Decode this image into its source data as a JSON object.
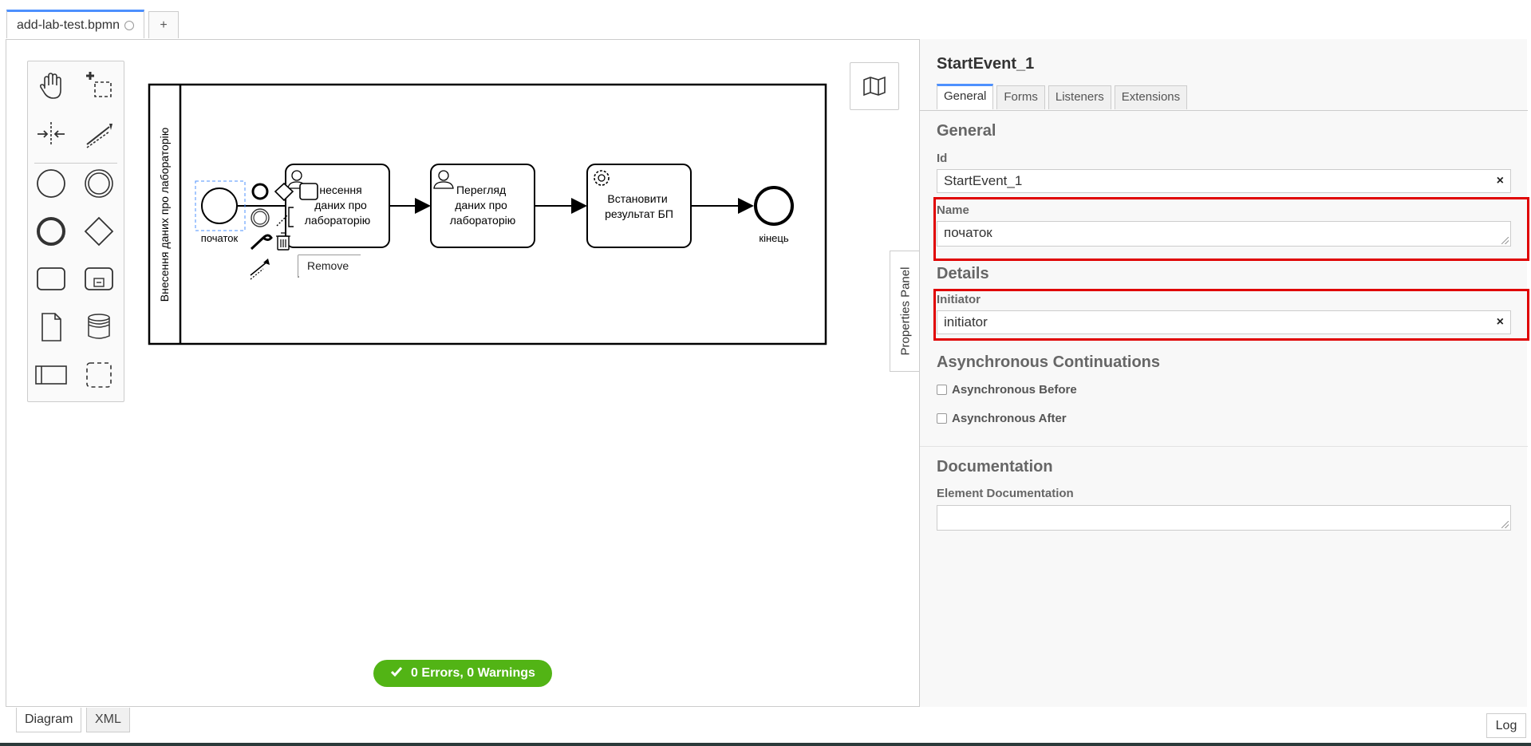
{
  "file_tab": {
    "name": "add-lab-test.bpmn"
  },
  "add_tab": {
    "label": "+"
  },
  "diagram": {
    "lane_label": "Внесення даних про лабораторію",
    "start_label": "початок",
    "task1": [
      "несення",
      "даних про",
      "лабораторію"
    ],
    "task2": [
      "Перегляд",
      "даних про",
      "лабораторію"
    ],
    "task3": [
      "Встановити",
      "результат БП"
    ],
    "end_label": "кінець",
    "context_tooltip": "Remove"
  },
  "status": {
    "text": "0 Errors, 0 Warnings"
  },
  "properties_toggle": {
    "label": "Properties Panel"
  },
  "panel": {
    "title": "StartEvent_1",
    "tabs": [
      "General",
      "Forms",
      "Listeners",
      "Extensions"
    ],
    "general_heading": "General",
    "id_label": "Id",
    "id_value": "StartEvent_1",
    "name_label": "Name",
    "name_value": "початок",
    "details_heading": "Details",
    "initiator_label": "Initiator",
    "initiator_value": "initiator",
    "async_heading": "Asynchronous Continuations",
    "async_before": "Asynchronous Before",
    "async_after": "Asynchronous After",
    "doc_heading": "Documentation",
    "doc_label": "Element Documentation",
    "doc_value": "",
    "clear_symbol": "×"
  },
  "bottom_tabs": {
    "diagram": "Diagram",
    "xml": "XML"
  },
  "log": {
    "label": "Log"
  },
  "colors": {
    "accent": "#4d90fe",
    "success": "#52b415",
    "highlight": "#e00000"
  }
}
